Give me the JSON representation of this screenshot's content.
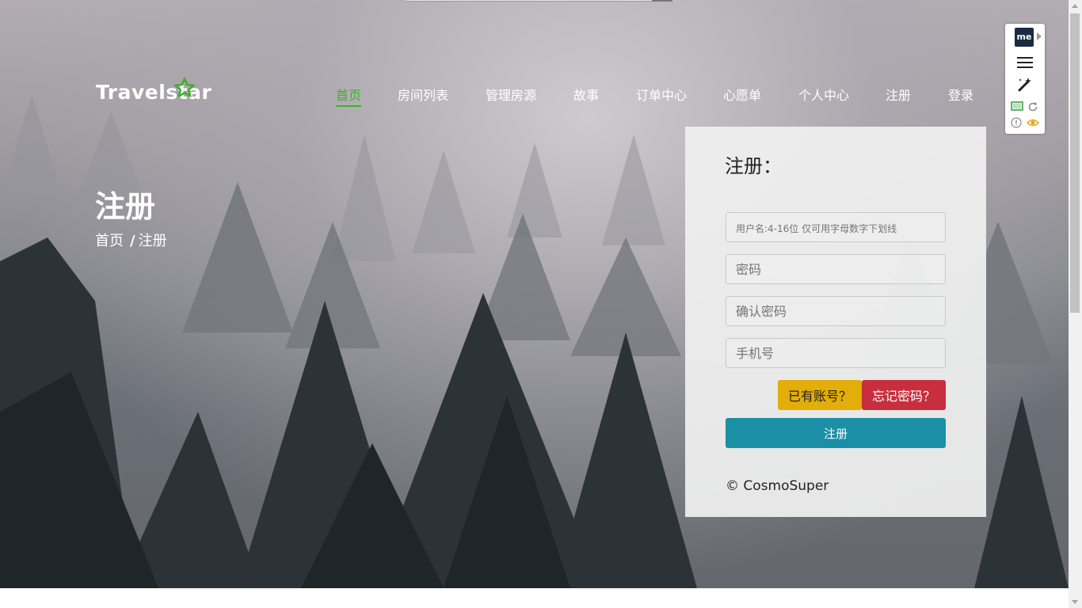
{
  "brand": {
    "logo_text": "Travelstar",
    "accent_color": "#3fb02a"
  },
  "nav": {
    "items": [
      {
        "label": "首页",
        "active": true
      },
      {
        "label": "房间列表",
        "active": false
      },
      {
        "label": "管理房源",
        "active": false
      },
      {
        "label": "故事",
        "active": false
      },
      {
        "label": "订单中心",
        "active": false
      },
      {
        "label": "心愿单",
        "active": false
      },
      {
        "label": "个人中心",
        "active": false
      },
      {
        "label": "注册",
        "active": false
      },
      {
        "label": "登录",
        "active": false
      }
    ]
  },
  "hero": {
    "title": "注册",
    "breadcrumb": {
      "home": "首页",
      "separator": "/",
      "current": "注册"
    }
  },
  "form": {
    "title": "注册：",
    "username_placeholder": "用户名:4-16位 仅可用字母数字下划线",
    "password_placeholder": "密码",
    "confirm_placeholder": "确认密码",
    "phone_placeholder": "手机号",
    "have_account_label": "已有账号？",
    "forgot_password_label": "忘记密码？",
    "submit_label": "注册",
    "copyright": "© CosmoSuper",
    "colors": {
      "have_account": "#e3ad0a",
      "forgot": "#c82f3e",
      "submit": "#1a8fa5"
    }
  },
  "extension": {
    "badge_text": "me",
    "icons": [
      "menu-icon",
      "magic-wand-icon",
      "cast-icon",
      "refresh-icon",
      "info-icon",
      "eye-icon"
    ]
  }
}
